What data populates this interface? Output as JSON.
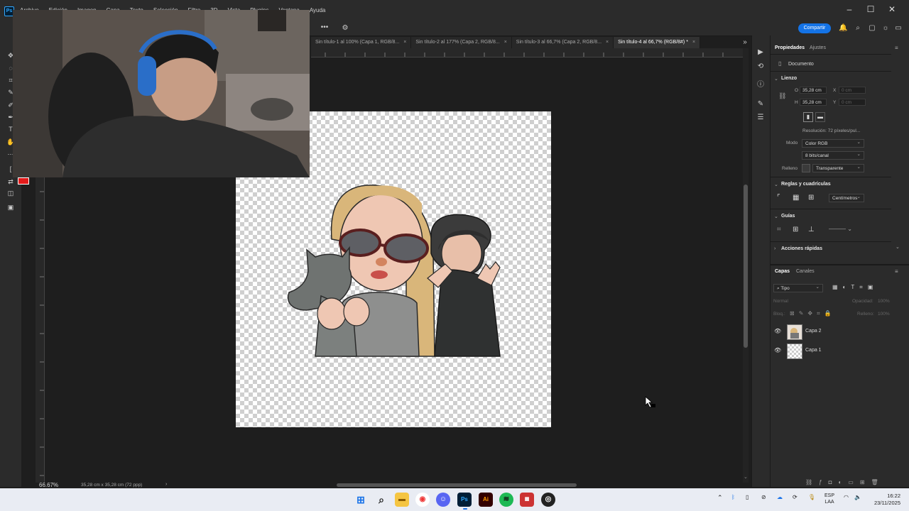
{
  "window": {
    "menu": [
      "Archivo",
      "Edición",
      "Imagen",
      "Capa",
      "Texto",
      "Selección",
      "Filtro",
      "3D",
      "Vista",
      "Plugins",
      "Ventana",
      "Ayuda"
    ]
  },
  "options_bar": {
    "share_label": "Compartir"
  },
  "tabs": [
    {
      "label": "Sin título-1 al 100% (Capa 1, RGB/8...",
      "active": false
    },
    {
      "label": "Sin título-2 al 177% (Capa 2, RGB/8...",
      "active": false
    },
    {
      "label": "Sin título-3 al 66,7% (Capa 2, RGB/8...",
      "active": false
    },
    {
      "label": "Sin título-4 al 66,7% (RGB/8#) *",
      "active": true
    }
  ],
  "colors": {
    "foreground": "#e31b1b",
    "accent": "#1473e6"
  },
  "status": {
    "zoom": "66.67%",
    "doc_info": "35,28 cm x 35,28 cm (72 ppp)"
  },
  "properties": {
    "tabs": [
      "Propiedades",
      "Ajustes"
    ],
    "doc_label": "Documento",
    "lienzo": {
      "title": "Lienzo",
      "w_label": "O",
      "w_value": "35,28 cm",
      "h_label": "H",
      "h_value": "35,28 cm",
      "x_label": "X",
      "x_value": "0 cm",
      "y_label": "Y",
      "y_value": "0 cm",
      "resolution": "Resolución: 72 píxeles/pul...",
      "mode_label": "Modo",
      "mode_value": "Color RGB",
      "bits_value": "8 bits/canal",
      "fill_label": "Relleno",
      "fill_value": "Transparente"
    },
    "rulers": {
      "title": "Reglas y cuadrículas",
      "units": "Centímetros"
    },
    "guides": {
      "title": "Guías"
    },
    "quick": {
      "title": "Acciones rápidas"
    }
  },
  "layers_panel": {
    "tabs": [
      "Capas",
      "Canales"
    ],
    "filter": "Tipo",
    "blend": "Normal",
    "opacity_label": "Opacidad:",
    "opacity_value": "100%",
    "lock_label": "Bloq.:",
    "fill_label": "Relleno:",
    "fill_value": "100%",
    "layers": [
      {
        "name": "Capa 2",
        "visible": true,
        "has_art": true
      },
      {
        "name": "Capa 1",
        "visible": true,
        "has_art": false
      }
    ]
  },
  "taskbar": {
    "apps": [
      "windows-start",
      "search",
      "file-explorer",
      "chrome",
      "discord",
      "photoshop",
      "illustrator",
      "spotify",
      "game-app",
      "obs"
    ],
    "lang": "ESP",
    "lang2": "LAA",
    "time": "16:22",
    "date": "23/11/2025"
  }
}
